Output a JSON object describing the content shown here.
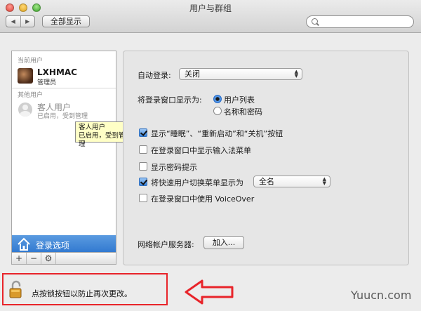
{
  "window": {
    "title": "用户与群组"
  },
  "toolbar": {
    "back_icon": "chevron-left-icon",
    "forward_icon": "chevron-right-icon",
    "show_all_label": "全部显示",
    "search_placeholder": "",
    "search_value": ""
  },
  "sidebar": {
    "current_users_label": "当前用户",
    "current_user": {
      "name": "LXHMAC",
      "role": "管理员"
    },
    "other_users_label": "其他用户",
    "guest_user": {
      "name": "客人用户",
      "status": "已启用，受到管理"
    },
    "tooltip": {
      "line1": "客人用户",
      "line2": "已启用，受到管理"
    },
    "login_options_label": "登录选项",
    "buttons": {
      "add": "+",
      "remove": "−",
      "gear_icon": "gear-icon"
    }
  },
  "login_settings": {
    "auto_login_label": "自动登录:",
    "auto_login_value": "关闭",
    "display_label": "将登录窗口显示为:",
    "display_options": [
      "用户列表",
      "名称和密码"
    ],
    "display_selected": "用户列表",
    "checkboxes": [
      {
        "label": "显示“睡眠”、“重新启动”和“关机”按钮",
        "checked": true
      },
      {
        "label": "在登录窗口中显示输入法菜单",
        "checked": false
      },
      {
        "label": "显示密码提示",
        "checked": false
      },
      {
        "label": "将快速用户切换菜单显示为",
        "checked": true
      },
      {
        "label": "在登录窗口中使用 VoiceOver",
        "checked": false
      }
    ],
    "fast_switch_value": "全名",
    "network_server_label": "网络帐户服务器:",
    "join_button_label": "加入..."
  },
  "lock": {
    "text": "点按锁按钮以防止再次更改。",
    "annotation_color": "#e8242a"
  },
  "watermark": "Yuucn.com"
}
